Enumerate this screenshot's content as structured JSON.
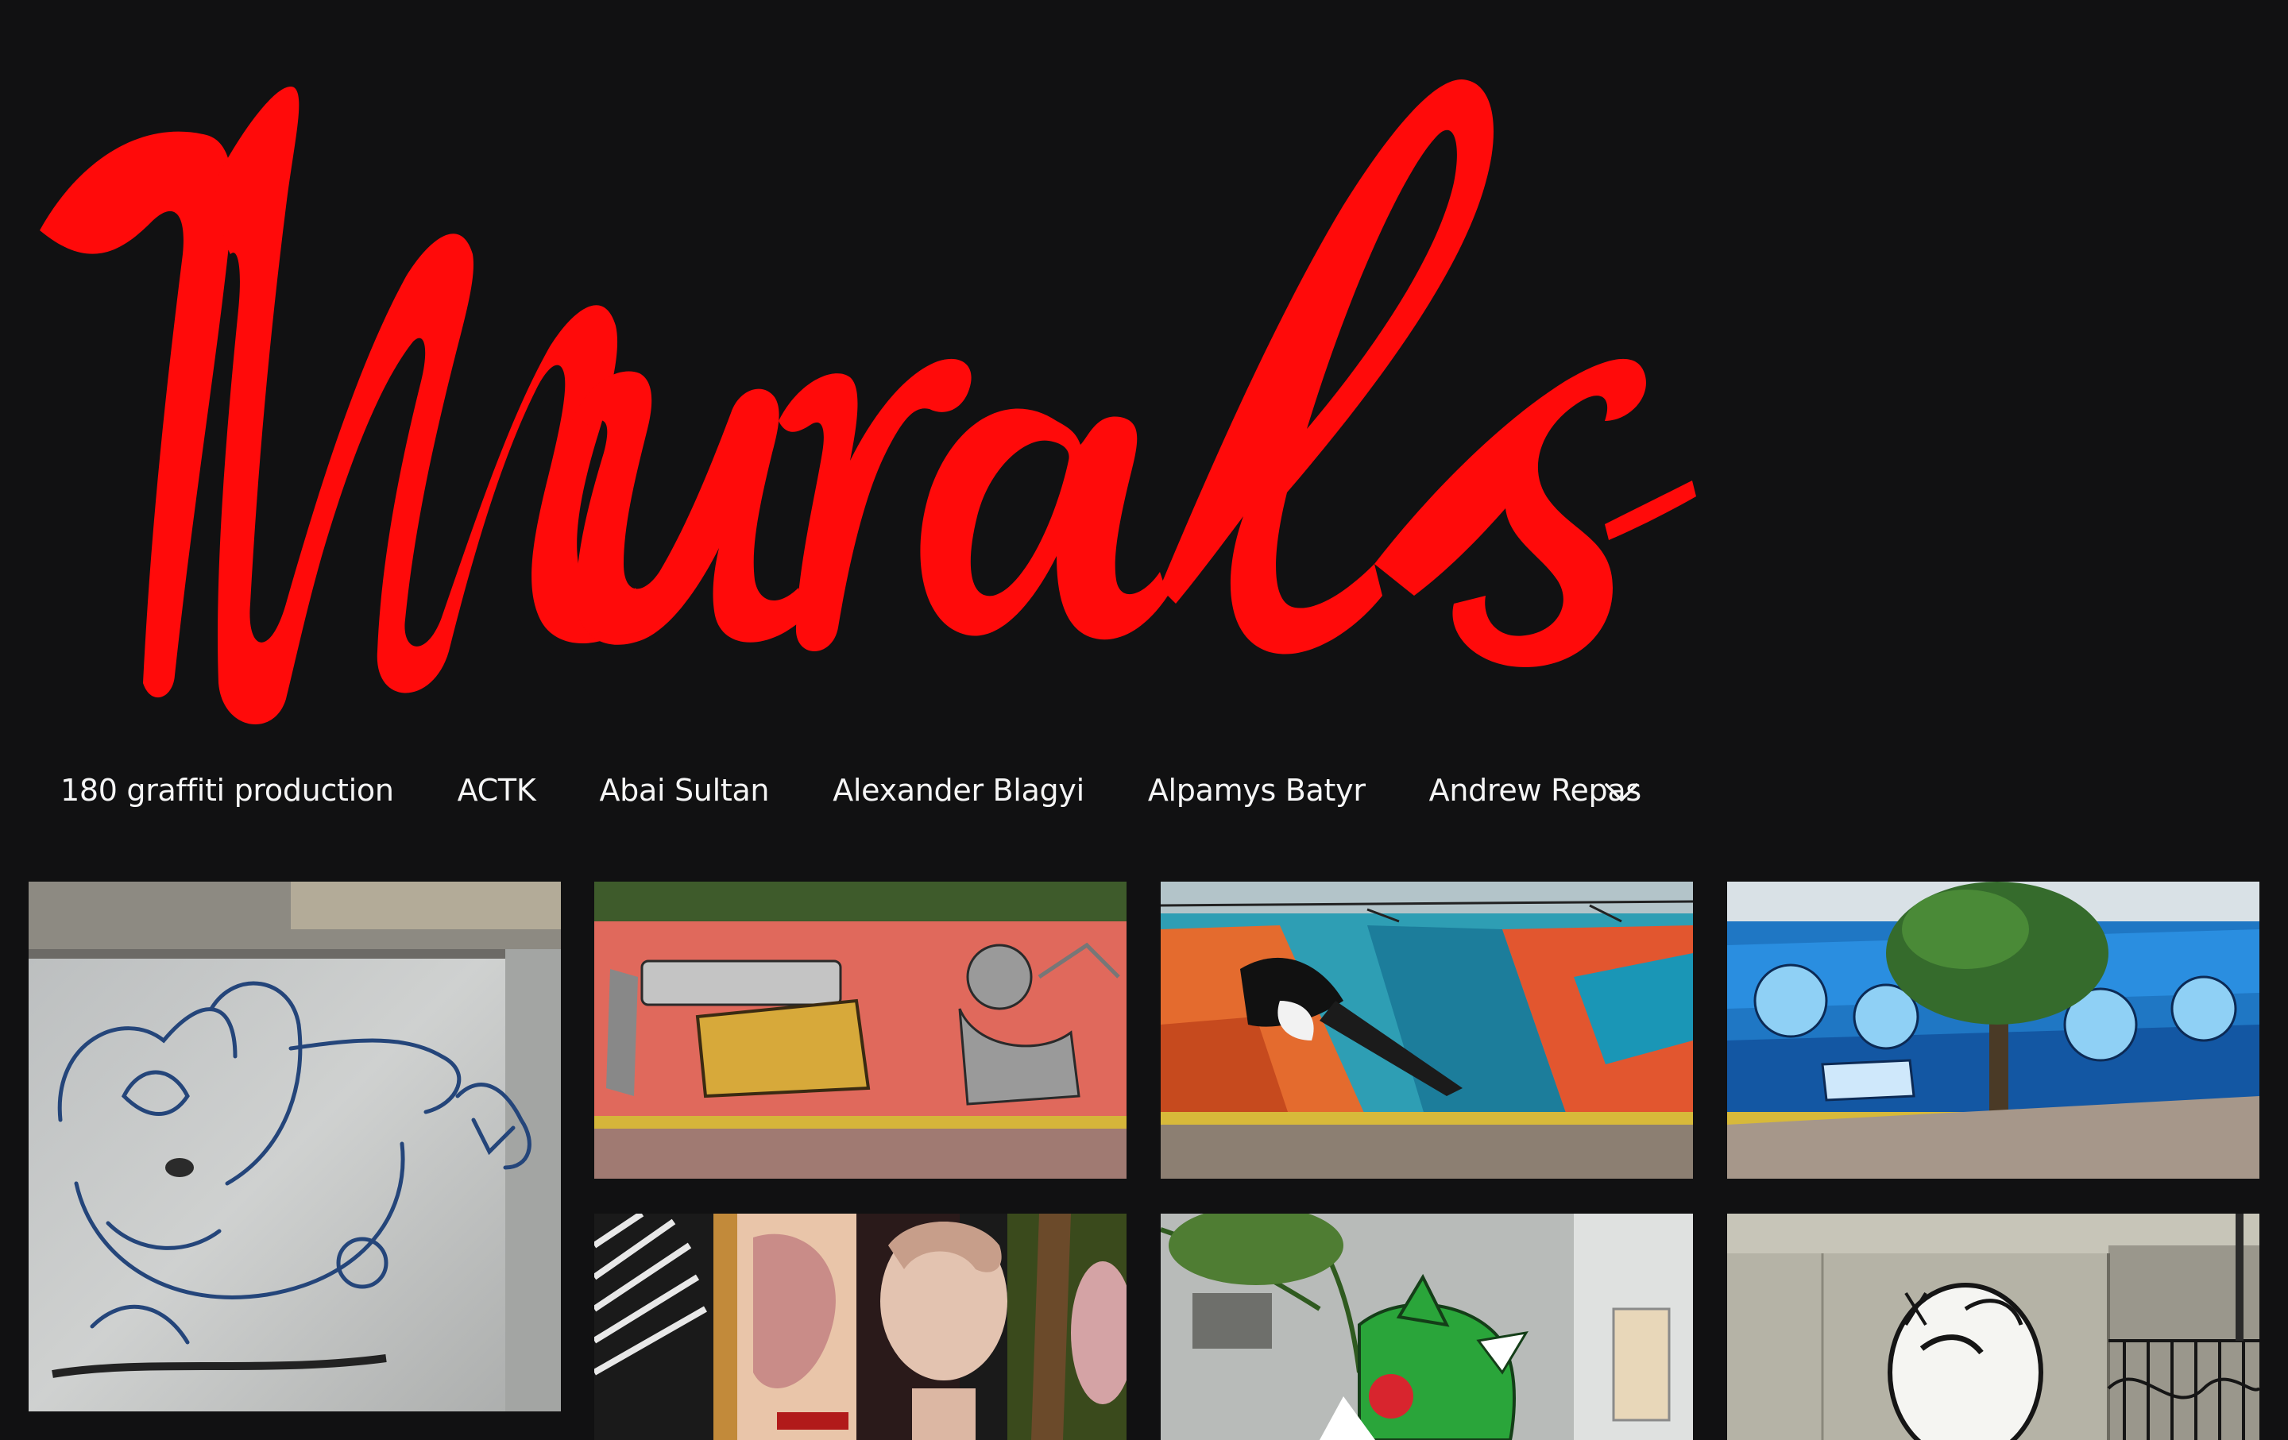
{
  "header": {
    "logo_text": "Murals",
    "logo_color": "#ff0a0a"
  },
  "nav": {
    "items": [
      {
        "label": "180 graffiti production"
      },
      {
        "label": "ACTK"
      },
      {
        "label": "Abai Sultan"
      },
      {
        "label": "Alexander Blagyi"
      },
      {
        "label": "Alpamys Batyr"
      },
      {
        "label": "Andrew Repas"
      }
    ],
    "more_icon": "chevron-down-icon"
  },
  "colors": {
    "background": "#111112",
    "nav_text": "#f5f5f5"
  }
}
